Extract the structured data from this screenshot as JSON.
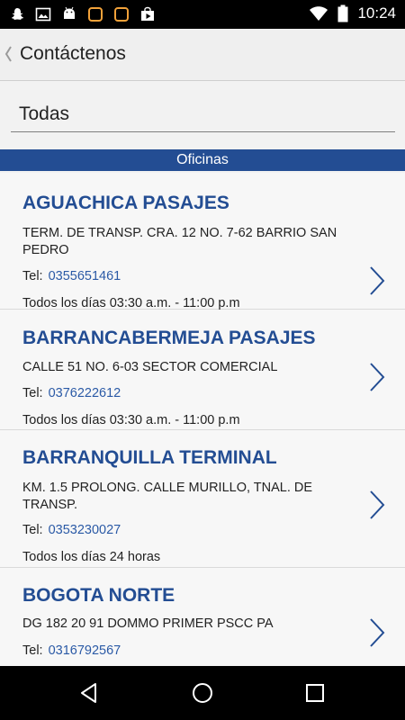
{
  "status_bar": {
    "time": "10:24",
    "icons": [
      "snapchat-icon",
      "image-icon",
      "android-icon",
      "square-app-icon",
      "square-app-icon",
      "play-store-icon",
      "wifi-icon",
      "battery-icon"
    ]
  },
  "app_bar": {
    "title": "Contáctenos",
    "back_icon": "chevron-left-icon"
  },
  "filter": {
    "value": "Todas"
  },
  "section": {
    "title": "Oficinas"
  },
  "offices": [
    {
      "name": "AGUACHICA PASAJES",
      "address": "TERM.  DE TRANSP. CRA. 12   NO.  7-62 BARRIO SAN PEDRO",
      "tel_label": "Tel:",
      "tel": "0355651461",
      "hours": "Todos los días 03:30 a.m. - 11:00 p.m"
    },
    {
      "name": "BARRANCABERMEJA PASAJES",
      "address": "CALLE 51  NO.  6-03 SECTOR COMERCIAL",
      "tel_label": "Tel:",
      "tel": "0376222612",
      "hours": "Todos los días 03:30 a.m. - 11:00 p.m"
    },
    {
      "name": "BARRANQUILLA TERMINAL",
      "address": "KM.  1.5 PROLONG. CALLE MURILLO, TNAL. DE TRANSP.",
      "tel_label": "Tel:",
      "tel": "0353230027",
      "hours": "Todos los días 24 horas"
    },
    {
      "name": "BOGOTA NORTE",
      "address": "DG 182 20 91 DOMMO PRIMER PSCC PA",
      "tel_label": "Tel:",
      "tel": "0316792567",
      "hours": ""
    }
  ],
  "nav_bar": {
    "icons": [
      "back-triangle-icon",
      "home-circle-icon",
      "recents-square-icon"
    ]
  }
}
